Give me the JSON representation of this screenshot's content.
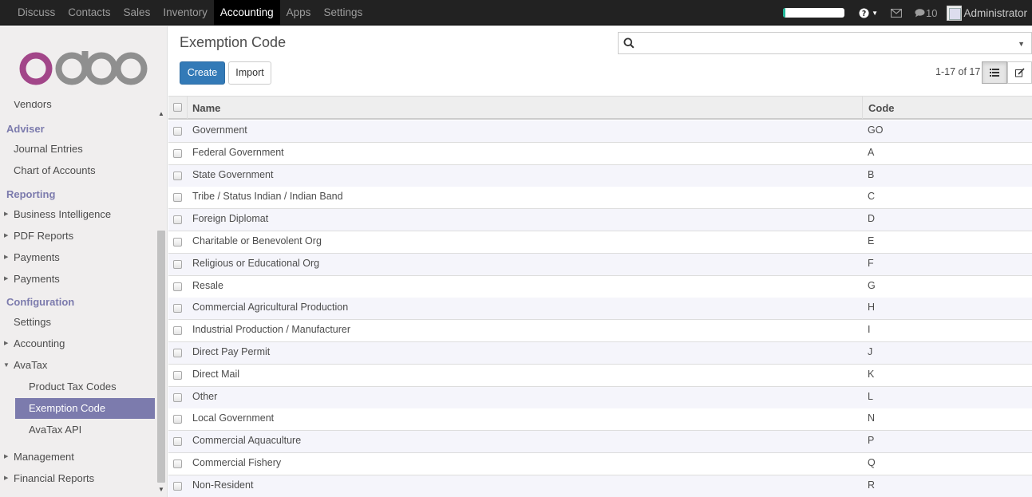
{
  "topbar": {
    "menu": [
      "Discuss",
      "Contacts",
      "Sales",
      "Inventory",
      "Accounting",
      "Apps",
      "Settings"
    ],
    "active_menu": "Accounting",
    "progress_fraction": 0.04,
    "message_count": "10",
    "user": "Administrator"
  },
  "sidebar": {
    "logo_text": "odoo",
    "cut_item": "Vendors",
    "sections": {
      "adviser": "Adviser",
      "reporting": "Reporting",
      "configuration": "Configuration"
    },
    "items": {
      "journal_entries": "Journal Entries",
      "chart_of_accounts": "Chart of Accounts",
      "business_intelligence": "Business Intelligence",
      "pdf_reports": "PDF Reports",
      "payments_1": "Payments",
      "payments_2": "Payments",
      "settings": "Settings",
      "accounting": "Accounting",
      "avatax": "AvaTax",
      "product_tax_codes": "Product Tax Codes",
      "exemption_code": "Exemption Code",
      "avatax_api": "AvaTax API",
      "management": "Management",
      "financial_reports": "Financial Reports"
    }
  },
  "main": {
    "title": "Exemption Code",
    "search_placeholder": "",
    "create_label": "Create",
    "import_label": "Import",
    "pager": "1-17 of 17"
  },
  "table": {
    "columns": {
      "name": "Name",
      "code": "Code"
    },
    "rows": [
      {
        "name": "Government",
        "code": "GO"
      },
      {
        "name": "Federal Government",
        "code": "A"
      },
      {
        "name": "State Government",
        "code": "B"
      },
      {
        "name": "Tribe / Status Indian / Indian Band",
        "code": "C"
      },
      {
        "name": "Foreign Diplomat",
        "code": "D"
      },
      {
        "name": "Charitable or Benevolent Org",
        "code": "E"
      },
      {
        "name": "Religious or Educational Org",
        "code": "F"
      },
      {
        "name": "Resale",
        "code": "G"
      },
      {
        "name": "Commercial Agricultural Production",
        "code": "H"
      },
      {
        "name": "Industrial Production / Manufacturer",
        "code": "I"
      },
      {
        "name": "Direct Pay Permit",
        "code": "J"
      },
      {
        "name": "Direct Mail",
        "code": "K"
      },
      {
        "name": "Other",
        "code": "L"
      },
      {
        "name": "Local Government",
        "code": "N"
      },
      {
        "name": "Commercial Aquaculture",
        "code": "P"
      },
      {
        "name": "Commercial Fishery",
        "code": "Q"
      },
      {
        "name": "Non-Resident",
        "code": "R"
      }
    ]
  },
  "colors": {
    "navbar": "#222222",
    "accent": "#7c7bad",
    "primary": "#337ab7",
    "progress": "#21b799"
  },
  "icons": {
    "help": "question-circle-icon",
    "mail": "envelope-icon",
    "chat": "comments-icon",
    "search": "search-icon",
    "list_view": "list-view-icon",
    "form_view": "edit-icon"
  }
}
